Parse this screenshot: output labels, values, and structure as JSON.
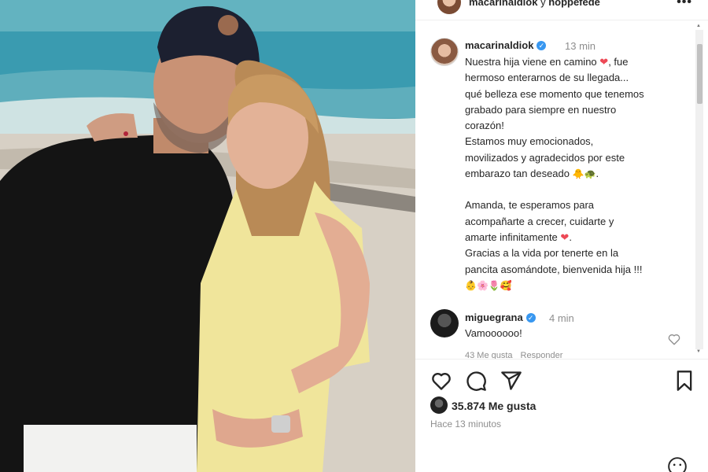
{
  "header": {
    "username": "macarinaldiok",
    "connector": "y",
    "collaborator": "hoppefede"
  },
  "caption": {
    "username": "macarinaldiok",
    "time": "13 min",
    "lines": [
      "Nuestra hija viene en camino",
      "hermoso enterarnos de su llegada...",
      "qué belleza ese momento que tenemos",
      "grabado para siempre en nuestro",
      "corazón!",
      "Estamos muy emocionados,",
      "movilizados y agradecidos por este",
      "embarazo tan deseado",
      "Amanda, te esperamos para",
      "acompañarte a crecer, cuidarte y",
      "amarte infinitamente",
      "Gracias a la vida por tenerte en la",
      "pancita asomándote, bienvenida hija !!!"
    ],
    "line1_tail": ", fue",
    "line10_tail": ".",
    "line7_tail": ".",
    "emoji_line7": "🐥🐢",
    "emoji_last": "👶🌸🌷🥰",
    "heart": "❤"
  },
  "comment": {
    "username": "miguegrana",
    "time": "4 min",
    "text": "Vamoooooo!",
    "likes": "43 Me gusta",
    "reply": "Responder"
  },
  "footer": {
    "likes": "35.874 Me gusta",
    "posted": "Hace 13 minutos"
  },
  "colors": {
    "verified": "#3897f0",
    "heart": "#ed4956",
    "text": "#262626",
    "muted": "#8e8e8e"
  },
  "icons": [
    "more-icon",
    "verified-icon",
    "heart-icon",
    "comment-icon",
    "share-icon",
    "bookmark-icon",
    "emoji-icon"
  ]
}
